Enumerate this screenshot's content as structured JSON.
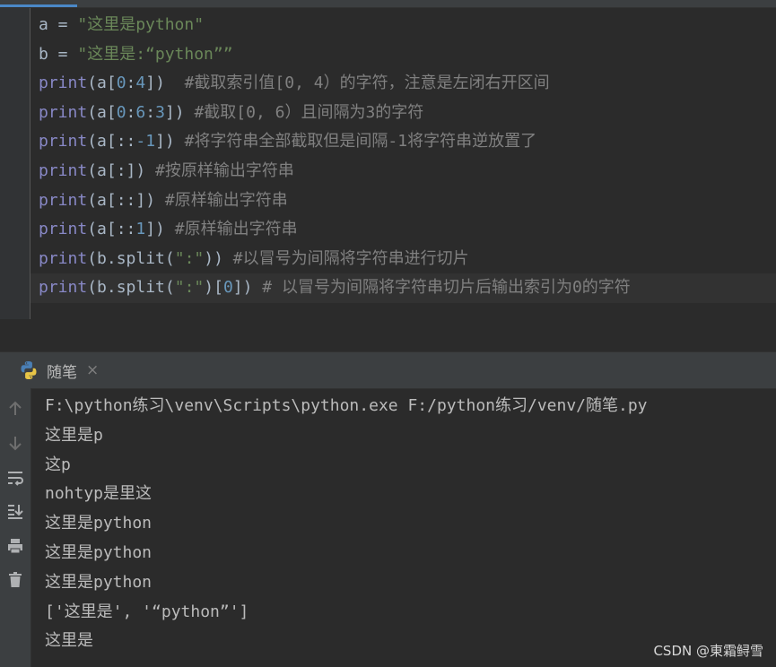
{
  "editor": {
    "lines": [
      [
        {
          "t": "plain",
          "v": "a = "
        },
        {
          "t": "str",
          "v": "\"这里是python\""
        }
      ],
      [
        {
          "t": "plain",
          "v": "b = "
        },
        {
          "t": "str",
          "v": "\"这里是:“python””"
        }
      ],
      [
        {
          "t": "kw",
          "v": "print"
        },
        {
          "t": "plain",
          "v": "(a["
        },
        {
          "t": "num",
          "v": "0"
        },
        {
          "t": "plain",
          "v": ":"
        },
        {
          "t": "num",
          "v": "4"
        },
        {
          "t": "plain",
          "v": "])  "
        },
        {
          "t": "cmt",
          "v": "#截取索引值[0, 4）的字符，注意是左闭右开区间"
        }
      ],
      [
        {
          "t": "kw",
          "v": "print"
        },
        {
          "t": "plain",
          "v": "(a["
        },
        {
          "t": "num",
          "v": "0"
        },
        {
          "t": "plain",
          "v": ":"
        },
        {
          "t": "num",
          "v": "6"
        },
        {
          "t": "plain",
          "v": ":"
        },
        {
          "t": "num",
          "v": "3"
        },
        {
          "t": "plain",
          "v": "]) "
        },
        {
          "t": "cmt",
          "v": "#截取[0, 6）且间隔为3的字符"
        }
      ],
      [
        {
          "t": "kw",
          "v": "print"
        },
        {
          "t": "plain",
          "v": "(a[::"
        },
        {
          "t": "num",
          "v": "-1"
        },
        {
          "t": "plain",
          "v": "]) "
        },
        {
          "t": "cmt",
          "v": "#将字符串全部截取但是间隔-1将字符串逆放置了"
        }
      ],
      [
        {
          "t": "kw",
          "v": "print"
        },
        {
          "t": "plain",
          "v": "(a[:]) "
        },
        {
          "t": "cmt",
          "v": "#按原样输出字符串"
        }
      ],
      [
        {
          "t": "kw",
          "v": "print"
        },
        {
          "t": "plain",
          "v": "(a[::]) "
        },
        {
          "t": "cmt",
          "v": "#原样输出字符串"
        }
      ],
      [
        {
          "t": "kw",
          "v": "print"
        },
        {
          "t": "plain",
          "v": "(a[::"
        },
        {
          "t": "num",
          "v": "1"
        },
        {
          "t": "plain",
          "v": "]) "
        },
        {
          "t": "cmt",
          "v": "#原样输出字符串"
        }
      ],
      [
        {
          "t": "kw",
          "v": "print"
        },
        {
          "t": "plain",
          "v": "(b.split("
        },
        {
          "t": "str",
          "v": "\":\""
        },
        {
          "t": "plain",
          "v": ")) "
        },
        {
          "t": "cmt",
          "v": "#以冒号为间隔将字符串进行切片"
        }
      ],
      [
        {
          "t": "kw",
          "v": "print"
        },
        {
          "t": "plain",
          "v": "(b.split("
        },
        {
          "t": "str",
          "v": "\":\""
        },
        {
          "t": "plain",
          "v": ")["
        },
        {
          "t": "num",
          "v": "0"
        },
        {
          "t": "plain",
          "v": "]) "
        },
        {
          "t": "cmt",
          "v": "# 以冒号为间隔将字符串切片后输出索引为0的字符"
        }
      ]
    ],
    "current_line": 9
  },
  "run": {
    "tab_label": "随笔",
    "tab_icon": "python-icon",
    "close_glyph": "×",
    "toolbar_icons": [
      "arrow-up-icon",
      "arrow-down-icon",
      "soft-wrap-icon",
      "scroll-to-end-icon",
      "print-icon",
      "trash-icon"
    ],
    "output": [
      "F:\\python练习\\venv\\Scripts\\python.exe F:/python练习/venv/随笔.py",
      "这里是p",
      "这p",
      "nohtyp是里这",
      "这里是python",
      "这里是python",
      "这里是python",
      "['这里是', '“python”']",
      "这里是"
    ]
  },
  "watermark": "CSDN @東霜鲟雪",
  "colors": {
    "background": "#2b2b2b",
    "keyword": "#8888c6",
    "string": "#6a8759",
    "number": "#6897bb",
    "comment": "#808080",
    "text": "#a9b7c6"
  }
}
